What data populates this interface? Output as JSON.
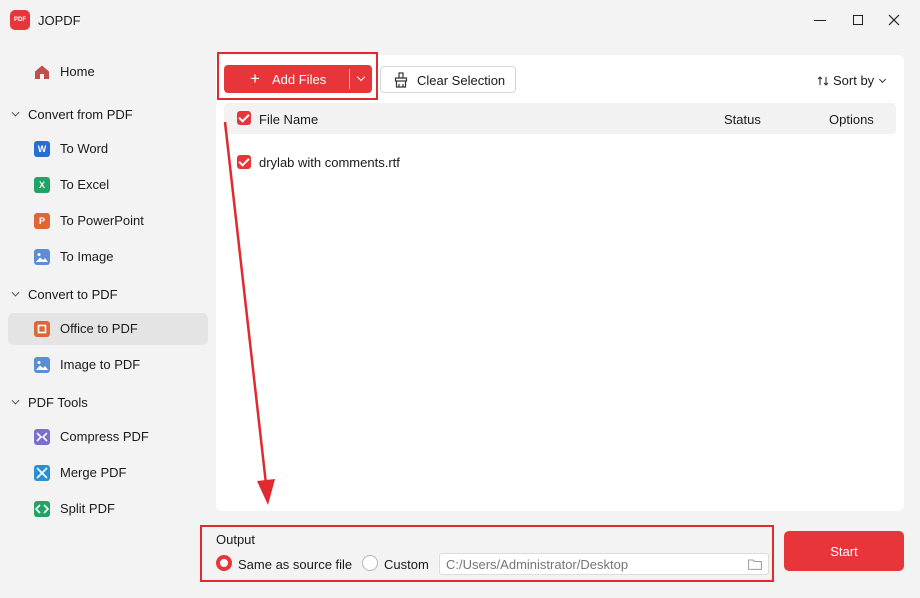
{
  "window": {
    "title": "JOPDF",
    "logo_text": "PDF"
  },
  "sidebar": {
    "home": "Home",
    "sections": [
      {
        "label": "Convert from PDF",
        "items": [
          "To Word",
          "To Excel",
          "To PowerPoint",
          "To Image"
        ]
      },
      {
        "label": "Convert to PDF",
        "items": [
          "Office to PDF",
          "Image to PDF"
        ]
      },
      {
        "label": "PDF Tools",
        "items": [
          "Compress PDF",
          "Merge PDF",
          "Split PDF"
        ]
      }
    ],
    "active_item": "Office to PDF"
  },
  "toolbar": {
    "add_files": "Add Files",
    "clear_selection": "Clear Selection",
    "sort_by": "Sort by"
  },
  "table": {
    "columns": {
      "file_name": "File Name",
      "status": "Status",
      "options": "Options"
    },
    "rows": [
      {
        "file_name": "drylab with comments.rtf",
        "checked": true
      }
    ]
  },
  "output": {
    "title": "Output",
    "same_as_source": "Same as source file",
    "custom": "Custom",
    "path_placeholder": "C:/Users/Administrator/Desktop",
    "selected": "same_as_source"
  },
  "start_label": "Start",
  "colors": {
    "accent": "#e8353a",
    "annotation": "#e02a2f"
  }
}
